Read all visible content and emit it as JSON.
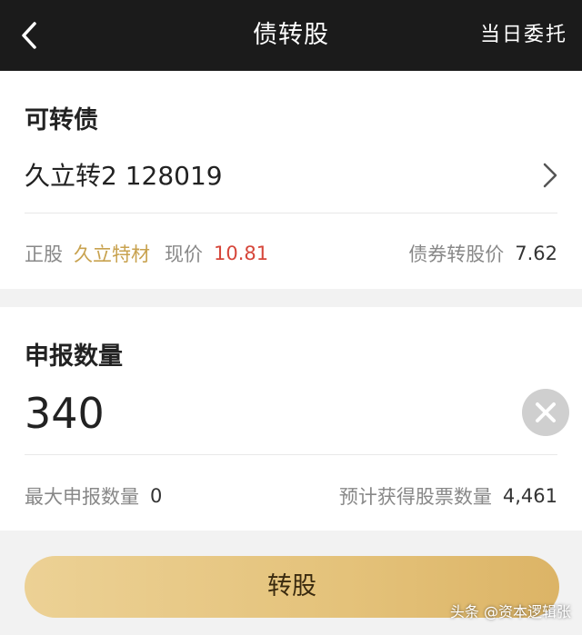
{
  "nav": {
    "title": "债转股",
    "right_label": "当日委托",
    "back_icon": "chevron-left-icon"
  },
  "bond_section": {
    "heading": "可转债",
    "bond_name": "久立转2 128019",
    "stock_label": "正股",
    "stock_name": "久立特材",
    "price_label": "现价",
    "price_value": "10.81",
    "conversion_price_label": "债券转股价",
    "conversion_price_value": "7.62"
  },
  "quantity_section": {
    "heading": "申报数量",
    "value": "340",
    "max_label": "最大申报数量",
    "max_value": "0",
    "expected_label": "预计获得股票数量",
    "expected_value": "4,461"
  },
  "submit": {
    "label": "转股"
  },
  "watermark": "头条 @资本逻辑张",
  "colors": {
    "nav_bg": "#1b1b1b",
    "accent_gold": "#c8a24f",
    "price_red": "#d6463a",
    "button_gold": "#e4c27a"
  }
}
